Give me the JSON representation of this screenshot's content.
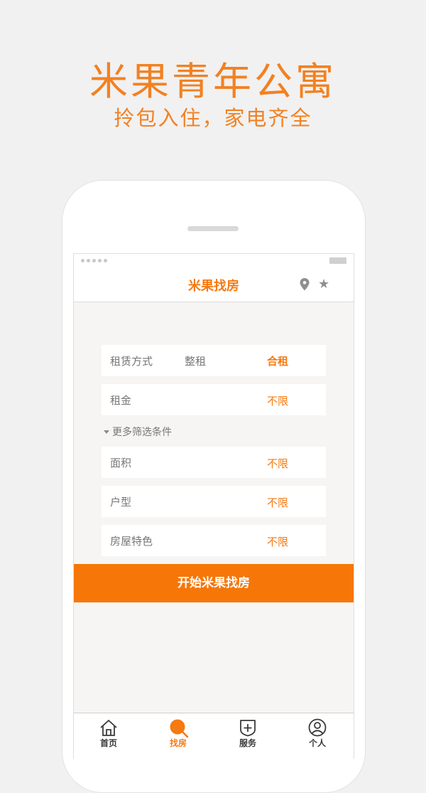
{
  "promo": {
    "title": "米果青年公寓",
    "subtitle": "拎包入住，家电齐全"
  },
  "navbar": {
    "title": "米果找房",
    "location_icon": "location-pin-icon",
    "favorite_icon": "star-icon"
  },
  "filters": {
    "rent_type": {
      "label": "租赁方式",
      "options": [
        "整租",
        "合租"
      ],
      "selected": "合租"
    },
    "rent": {
      "label": "租金",
      "value": "不限"
    },
    "more_toggle": "更多筛选条件",
    "area": {
      "label": "面积",
      "value": "不限"
    },
    "layout": {
      "label": "户型",
      "value": "不限"
    },
    "features": {
      "label": "房屋特色",
      "value": "不限"
    }
  },
  "cta": {
    "label": "开始米果找房"
  },
  "tabs": [
    {
      "label": "首页",
      "icon": "home-icon",
      "active": false
    },
    {
      "label": "找房",
      "icon": "search-icon",
      "active": true
    },
    {
      "label": "服务",
      "icon": "service-plus-icon",
      "active": false
    },
    {
      "label": "个人",
      "icon": "user-icon",
      "active": false
    }
  ],
  "colors": {
    "accent": "#f57a12",
    "button": "#f77608",
    "promo_text": "#f28122",
    "screen_bg": "#f6f5f3"
  }
}
